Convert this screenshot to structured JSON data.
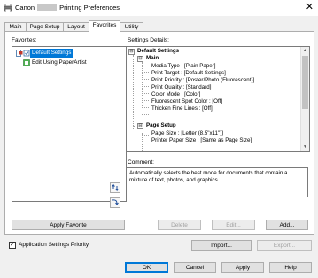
{
  "window": {
    "title_prefix": "Canon",
    "title_suffix": "Printing Preferences",
    "close_glyph": "✕"
  },
  "tabs": [
    {
      "label": "Main"
    },
    {
      "label": "Page Setup"
    },
    {
      "label": "Layout"
    },
    {
      "label": "Favorites"
    },
    {
      "label": "Utility"
    }
  ],
  "active_tab": "Favorites",
  "favorites": {
    "label": "Favorites:",
    "items": [
      {
        "label": "Default Settings",
        "selected": true,
        "icon": "printer-settings-icon"
      },
      {
        "label": "Edit Using PaperArtist",
        "selected": false,
        "icon": "paperartist-icon"
      }
    ],
    "apply_button": "Apply Favorite"
  },
  "settings_details": {
    "label": "Settings Details:",
    "lines": [
      {
        "text": "Default Settings",
        "bold": true,
        "expander": "⊟"
      },
      {
        "text": "Main",
        "bold": true,
        "expander": "⊟"
      },
      {
        "text": "Media Type : [Plain Paper]"
      },
      {
        "text": "Print Target : [Default Settings]"
      },
      {
        "text": "Print Priority : [Poster/Photo (Fluorescent)]"
      },
      {
        "text": "Print Quality : [Standard]"
      },
      {
        "text": "Color Mode : [Color]"
      },
      {
        "text": "Fluorescent Spot Color : [Off]"
      },
      {
        "text": "Thicken Fine Lines : [Off]"
      },
      {
        "text": "Page Setup",
        "bold": true,
        "expander": "⊟"
      },
      {
        "text": "Page Size : [Letter (8.5\"x11\")]"
      },
      {
        "text": "Printer Paper Size : [Same as Page Size]"
      }
    ]
  },
  "comment": {
    "label": "Comment:",
    "text": "Automatically selects the best mode for documents that contain a mixture of text, photos, and graphics."
  },
  "buttons": {
    "delete": "Delete",
    "edit": "Edit...",
    "add": "Add...",
    "import": "Import...",
    "export": "Export...",
    "ok": "OK",
    "cancel": "Cancel",
    "apply": "Apply",
    "help": "Help"
  },
  "app_settings_priority": {
    "label": "Application Settings Priority",
    "checked": true,
    "check_glyph": "✓"
  }
}
